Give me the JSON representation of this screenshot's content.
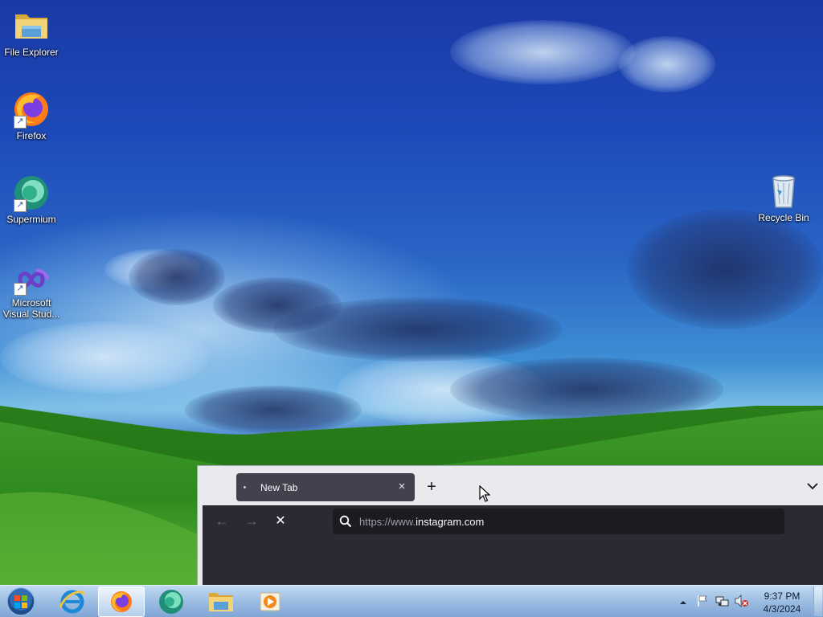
{
  "desktop": {
    "icons": [
      {
        "label": "File Explorer",
        "icon": "folder-icon",
        "shortcut": false
      },
      {
        "label": "Firefox",
        "icon": "firefox-icon",
        "shortcut": true
      },
      {
        "label": "Supermium",
        "icon": "supermium-icon",
        "shortcut": true
      },
      {
        "label": "Microsoft Visual Stud...",
        "label_line1": "Microsoft",
        "label_line2": "Visual Stud...",
        "icon": "visual-studio-icon",
        "shortcut": true
      },
      {
        "label": "Recycle Bin",
        "icon": "recycle-bin-icon",
        "shortcut": false
      }
    ]
  },
  "browser": {
    "tab": {
      "title": "New Tab",
      "close_glyph": "×",
      "state": "loading"
    },
    "new_tab_glyph": "+",
    "tab_list_icon": "chevron-down-icon",
    "nav": {
      "back_glyph": "←",
      "forward_glyph": "→",
      "stop_glyph": "✕"
    },
    "url": {
      "scheme_prefix": "https://www.",
      "host": "instagram.com",
      "full": "https://www.instagram.com",
      "search_icon": "search-icon"
    }
  },
  "taskbar": {
    "start_icon": "windows-start-orb-icon",
    "pinned": [
      {
        "name": "internet-explorer",
        "icon": "internet-explorer-icon",
        "active": false
      },
      {
        "name": "firefox",
        "icon": "firefox-icon",
        "active": true
      },
      {
        "name": "supermium",
        "icon": "supermium-icon",
        "active": false
      },
      {
        "name": "file-explorer",
        "icon": "folder-icon",
        "active": false
      },
      {
        "name": "media-player",
        "icon": "media-player-icon",
        "active": false
      }
    ],
    "tray": {
      "icons": [
        "show-hidden-icons-icon",
        "action-center-flag-icon",
        "network-icon",
        "volume-muted-icon"
      ],
      "time": "9:37 PM",
      "date": "4/3/2024"
    }
  },
  "colors": {
    "browser_toolbar": "#2b2a33",
    "tab_active": "#42414d",
    "tab_strip": "#e9eaee",
    "url_field": "#1c1b22",
    "taskbar": "#9bbde3"
  }
}
